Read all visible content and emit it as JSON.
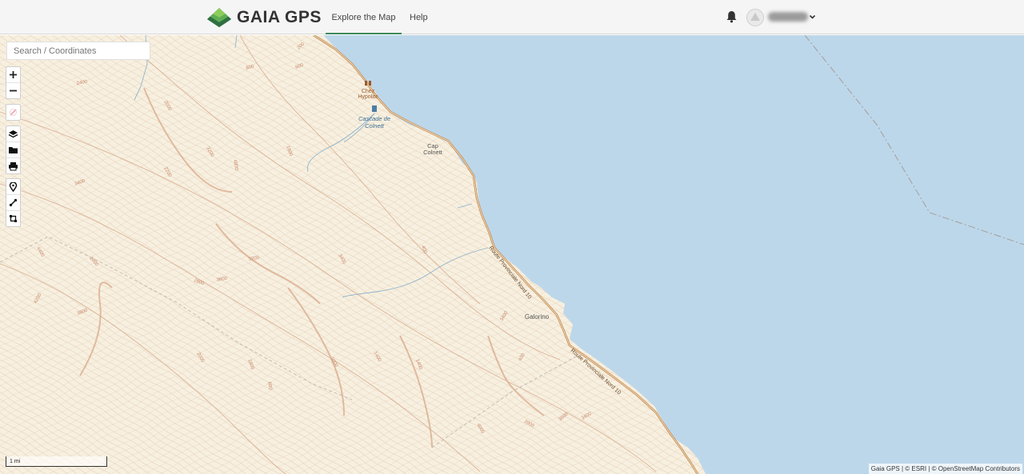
{
  "header": {
    "logo_text": "GAIA GPS",
    "nav": {
      "explore": "Explore the Map",
      "help": "Help"
    },
    "username": "user"
  },
  "search": {
    "placeholder": "Search / Coordinates"
  },
  "map": {
    "places": {
      "chez_1": "Chez",
      "chez_2": "Hypolite",
      "cascade_1": "Cascade de",
      "cascade_2": "Colnett",
      "cap_1": "Cap",
      "cap_2": "Colnett",
      "galorino": "Galorino",
      "road_1": "Route Provinciale Nord 10",
      "road_2": "Route Provinciale Nord 10"
    },
    "contours": {
      "c1": "600",
      "c2": "800",
      "c3": "200",
      "c4": "2400",
      "c5": "2000",
      "c6": "3400",
      "c7": "2200",
      "c8": "3200",
      "c9": "1800",
      "c10": "4000",
      "c11": "4400",
      "c12": "2600",
      "c13": "400",
      "c14": "3200",
      "c15": "3400",
      "c16": "2800",
      "c17": "3600",
      "c18": "4200",
      "c19": "3800",
      "c20": "3400",
      "c21": "1400",
      "c22": "2000",
      "c23": "1400",
      "c24": "1000",
      "c25": "400",
      "c26": "1800",
      "c27": "600",
      "c28": "3600",
      "c29": "2000",
      "c30": "3400",
      "c31": "4000"
    },
    "scale": "1 mi",
    "attribution": "Gaia GPS | © ESRI | © OpenStreetMap Contributors",
    "colors": {
      "land": "#f7f0e0",
      "water": "#bdd7ea",
      "contour": "#c98a6a",
      "road": "#c0894e",
      "stream": "#8fb4cc"
    }
  }
}
